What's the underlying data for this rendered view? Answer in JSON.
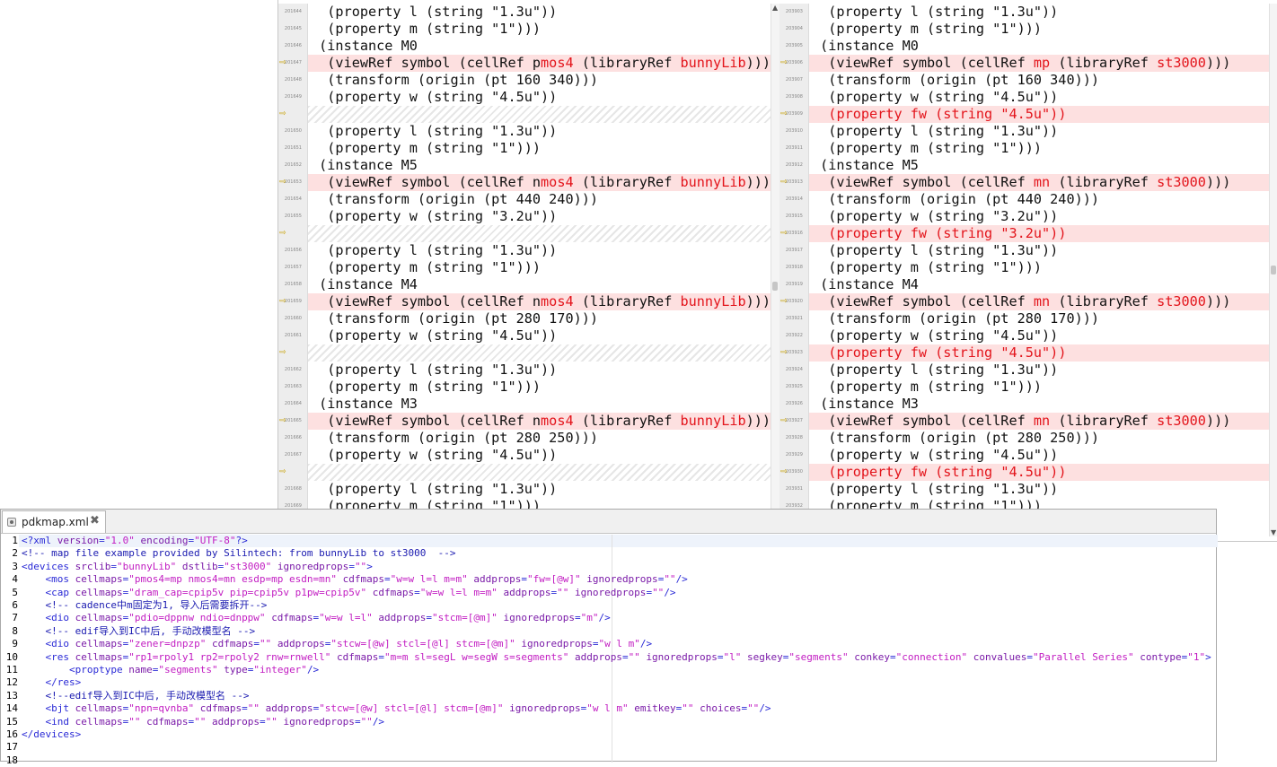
{
  "diff": {
    "left": {
      "rows": [
        {
          "num": "201644",
          "text": "  (property l (string \"1.3u\"))",
          "kind": "normal"
        },
        {
          "num": "201645",
          "text": "  (property m (string \"1\")))",
          "kind": "normal"
        },
        {
          "num": "201646",
          "text": " (instance M0",
          "kind": "normal"
        },
        {
          "num": "201647",
          "text": "  (viewRef symbol (cellRef pmos4 (libraryRef bunnyLib)))",
          "kind": "diff",
          "redParts": [
            "mos4",
            "bunnyLib"
          ]
        },
        {
          "num": "201648",
          "text": "  (transform (origin (pt 160 340)))",
          "kind": "normal"
        },
        {
          "num": "201649",
          "text": "  (property w (string \"4.5u\"))",
          "kind": "normal"
        },
        {
          "num": "",
          "text": "",
          "kind": "placeholder"
        },
        {
          "num": "201650",
          "text": "  (property l (string \"1.3u\"))",
          "kind": "normal"
        },
        {
          "num": "201651",
          "text": "  (property m (string \"1\")))",
          "kind": "normal"
        },
        {
          "num": "201652",
          "text": " (instance M5",
          "kind": "normal"
        },
        {
          "num": "201653",
          "text": "  (viewRef symbol (cellRef nmos4 (libraryRef bunnyLib)))",
          "kind": "diff",
          "redParts": [
            "mos4",
            "bunnyLib"
          ]
        },
        {
          "num": "201654",
          "text": "  (transform (origin (pt 440 240)))",
          "kind": "normal"
        },
        {
          "num": "201655",
          "text": "  (property w (string \"3.2u\"))",
          "kind": "normal"
        },
        {
          "num": "",
          "text": "",
          "kind": "placeholder"
        },
        {
          "num": "201656",
          "text": "  (property l (string \"1.3u\"))",
          "kind": "normal"
        },
        {
          "num": "201657",
          "text": "  (property m (string \"1\")))",
          "kind": "normal"
        },
        {
          "num": "201658",
          "text": " (instance M4",
          "kind": "normal"
        },
        {
          "num": "201659",
          "text": "  (viewRef symbol (cellRef nmos4 (libraryRef bunnyLib)))",
          "kind": "diff",
          "redParts": [
            "mos4",
            "bunnyLib"
          ]
        },
        {
          "num": "201660",
          "text": "  (transform (origin (pt 280 170)))",
          "kind": "normal"
        },
        {
          "num": "201661",
          "text": "  (property w (string \"4.5u\"))",
          "kind": "normal"
        },
        {
          "num": "",
          "text": "",
          "kind": "placeholder"
        },
        {
          "num": "201662",
          "text": "  (property l (string \"1.3u\"))",
          "kind": "normal"
        },
        {
          "num": "201663",
          "text": "  (property m (string \"1\")))",
          "kind": "normal"
        },
        {
          "num": "201664",
          "text": " (instance M3",
          "kind": "normal"
        },
        {
          "num": "201665",
          "text": "  (viewRef symbol (cellRef nmos4 (libraryRef bunnyLib)))",
          "kind": "diff",
          "redParts": [
            "mos4",
            "bunnyLib"
          ]
        },
        {
          "num": "201666",
          "text": "  (transform (origin (pt 280 250)))",
          "kind": "normal"
        },
        {
          "num": "201667",
          "text": "  (property w (string \"4.5u\"))",
          "kind": "normal"
        },
        {
          "num": "",
          "text": "",
          "kind": "placeholder"
        },
        {
          "num": "201668",
          "text": "  (property l (string \"1.3u\"))",
          "kind": "normal"
        },
        {
          "num": "201669",
          "text": "  (property m (string \"1\")))",
          "kind": "normal"
        }
      ]
    },
    "right": {
      "rows": [
        {
          "num": "203903",
          "text": "  (property l (string \"1.3u\"))",
          "kind": "normal"
        },
        {
          "num": "203904",
          "text": "  (property m (string \"1\")))",
          "kind": "normal"
        },
        {
          "num": "203905",
          "text": " (instance M0",
          "kind": "normal"
        },
        {
          "num": "203906",
          "text": "  (viewRef symbol (cellRef mp (libraryRef st3000)))",
          "kind": "diff",
          "redParts": [
            "mp",
            "st3000"
          ]
        },
        {
          "num": "203907",
          "text": "  (transform (origin (pt 160 340)))",
          "kind": "normal"
        },
        {
          "num": "203908",
          "text": "  (property w (string \"4.5u\"))",
          "kind": "normal"
        },
        {
          "num": "203909",
          "text": "  (property fw (string \"4.5u\"))",
          "kind": "diff",
          "allRed": true
        },
        {
          "num": "203910",
          "text": "  (property l (string \"1.3u\"))",
          "kind": "normal"
        },
        {
          "num": "203911",
          "text": "  (property m (string \"1\")))",
          "kind": "normal"
        },
        {
          "num": "203912",
          "text": " (instance M5",
          "kind": "normal"
        },
        {
          "num": "203913",
          "text": "  (viewRef symbol (cellRef mn (libraryRef st3000)))",
          "kind": "diff",
          "redParts": [
            "mn",
            "st3000"
          ]
        },
        {
          "num": "203914",
          "text": "  (transform (origin (pt 440 240)))",
          "kind": "normal"
        },
        {
          "num": "203915",
          "text": "  (property w (string \"3.2u\"))",
          "kind": "normal"
        },
        {
          "num": "203916",
          "text": "  (property fw (string \"3.2u\"))",
          "kind": "diff",
          "allRed": true
        },
        {
          "num": "203917",
          "text": "  (property l (string \"1.3u\"))",
          "kind": "normal"
        },
        {
          "num": "203918",
          "text": "  (property m (string \"1\")))",
          "kind": "normal"
        },
        {
          "num": "203919",
          "text": " (instance M4",
          "kind": "normal"
        },
        {
          "num": "203920",
          "text": "  (viewRef symbol (cellRef mn (libraryRef st3000)))",
          "kind": "diff",
          "redParts": [
            "mn",
            "st3000"
          ]
        },
        {
          "num": "203921",
          "text": "  (transform (origin (pt 280 170)))",
          "kind": "normal"
        },
        {
          "num": "203922",
          "text": "  (property w (string \"4.5u\"))",
          "kind": "normal"
        },
        {
          "num": "203923",
          "text": "  (property fw (string \"4.5u\"))",
          "kind": "diff",
          "allRed": true
        },
        {
          "num": "203924",
          "text": "  (property l (string \"1.3u\"))",
          "kind": "normal"
        },
        {
          "num": "203925",
          "text": "  (property m (string \"1\")))",
          "kind": "normal"
        },
        {
          "num": "203926",
          "text": " (instance M3",
          "kind": "normal"
        },
        {
          "num": "203927",
          "text": "  (viewRef symbol (cellRef mn (libraryRef st3000)))",
          "kind": "diff",
          "redParts": [
            "mn",
            "st3000"
          ]
        },
        {
          "num": "203928",
          "text": "  (transform (origin (pt 280 250)))",
          "kind": "normal"
        },
        {
          "num": "203929",
          "text": "  (property w (string \"4.5u\"))",
          "kind": "normal"
        },
        {
          "num": "203930",
          "text": "  (property fw (string \"4.5u\"))",
          "kind": "diff",
          "allRed": true
        },
        {
          "num": "203931",
          "text": "  (property l (string \"1.3u\"))",
          "kind": "normal"
        },
        {
          "num": "203932",
          "text": "  (property m (string \"1\")))",
          "kind": "normal"
        }
      ]
    },
    "colors": {
      "diff_bg": "#fde0e0",
      "red_text": "#e3141b",
      "arrow": "#c8a000"
    }
  },
  "editor": {
    "tab_label": "pdkmap.xml",
    "tab_icon": "xml-file-icon",
    "close_icon": "close-icon",
    "lines": [
      {
        "n": "1",
        "text": "<?xml version=\"1.0\" encoding=\"UTF-8\"?>"
      },
      {
        "n": "2",
        "text": "<!-- map file example provided by Silintech: from bunnyLib to st3000  -->"
      },
      {
        "n": "3",
        "text": "<devices srclib=\"bunnyLib\" dstlib=\"st3000\" ignoredprops=\"\">"
      },
      {
        "n": "4",
        "text": "    <mos cellmaps=\"pmos4=mp nmos4=mn esdp=mp esdn=mn\" cdfmaps=\"w=w l=l m=m\" addprops=\"fw=[@w]\" ignoredprops=\"\"/>"
      },
      {
        "n": "5",
        "text": "    <cap cellmaps=\"dram_cap=cpip5v pip=cpip5v p1pw=cpip5v\" cdfmaps=\"w=w l=l m=m\" addprops=\"\" ignoredprops=\"\"/>"
      },
      {
        "n": "6",
        "text": "    <!-- cadence中m固定为1, 导入后需要拆开-->"
      },
      {
        "n": "7",
        "text": "    <dio cellmaps=\"pdio=dppnw ndio=dnppw\" cdfmaps=\"w=w l=l\" addprops=\"stcm=[@m]\" ignoredprops=\"m\"/>"
      },
      {
        "n": "8",
        "text": "    <!-- edif导入到IC中后, 手动改模型名 -->"
      },
      {
        "n": "9",
        "text": "    <dio cellmaps=\"zener=dnpzp\" cdfmaps=\"\" addprops=\"stcw=[@w] stcl=[@l] stcm=[@m]\" ignoredprops=\"w l m\"/>"
      },
      {
        "n": "10",
        "text": "    <res cellmaps=\"rp1=rpoly1 rp2=rpoly2 rnw=rnwell\" cdfmaps=\"m=m sl=segL w=segW s=segments\" addprops=\"\" ignoredprops=\"l\" segkey=\"segments\" conkey=\"connection\" convalues=\"Parallel Series\" contype=\"1\">"
      },
      {
        "n": "11",
        "text": "        <proptype name=\"segments\" type=\"integer\"/>"
      },
      {
        "n": "12",
        "text": "    </res>"
      },
      {
        "n": "13",
        "text": "    <!--edif导入到IC中后, 手动改模型名 -->"
      },
      {
        "n": "14",
        "text": "    <bjt cellmaps=\"npn=qvnba\" cdfmaps=\"\" addprops=\"stcw=[@w] stcl=[@l] stcm=[@m]\" ignoredprops=\"w l m\" emitkey=\"\" choices=\"\"/>"
      },
      {
        "n": "15",
        "text": "    <ind cellmaps=\"\" cdfmaps=\"\" addprops=\"\" ignoredprops=\"\"/>"
      },
      {
        "n": "16",
        "text": "</devices>"
      },
      {
        "n": "17",
        "text": ""
      },
      {
        "n": "18",
        "text": ""
      }
    ],
    "colors": {
      "tag": "#2a2ad6",
      "attr": "#7a1aa8",
      "value": "#c21dc2",
      "comment": "#1a1ab0"
    }
  }
}
